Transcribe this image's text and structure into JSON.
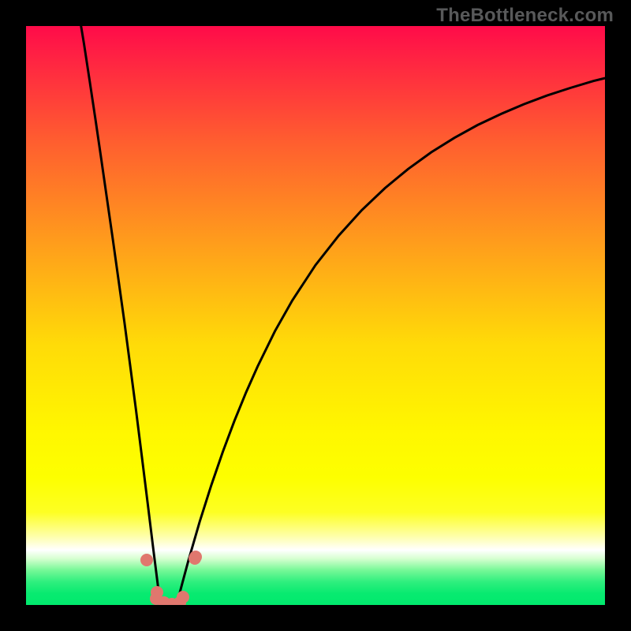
{
  "watermark": "TheBottleneck.com",
  "chart_data": {
    "type": "line",
    "title": "",
    "xlabel": "",
    "ylabel": "",
    "xlim": [
      0,
      100
    ],
    "ylim": [
      0,
      100
    ],
    "series": [
      {
        "name": "left-curve",
        "values_xy": [
          [
            9,
            103
          ],
          [
            10,
            97
          ],
          [
            11,
            90.5
          ],
          [
            12,
            83.8
          ],
          [
            13,
            77
          ],
          [
            14,
            70
          ],
          [
            15,
            63.1
          ],
          [
            16,
            56
          ],
          [
            17,
            48.8
          ],
          [
            18,
            41.3
          ],
          [
            19,
            33.6
          ],
          [
            20,
            25.7
          ],
          [
            21,
            17.7
          ],
          [
            22,
            9.5
          ],
          [
            23.2,
            0
          ]
        ],
        "note": "near-vertical descending branch on left third"
      },
      {
        "name": "right-curve",
        "values_xy": [
          [
            26,
            0
          ],
          [
            27,
            3.8
          ],
          [
            28,
            7.5
          ],
          [
            30,
            14.4
          ],
          [
            32,
            20.7
          ],
          [
            34,
            26.5
          ],
          [
            36,
            31.8
          ],
          [
            38,
            36.7
          ],
          [
            40,
            41.2
          ],
          [
            43,
            47.3
          ],
          [
            46,
            52.6
          ],
          [
            50,
            58.7
          ],
          [
            54,
            63.8
          ],
          [
            58,
            68.2
          ],
          [
            62,
            72
          ],
          [
            66,
            75.3
          ],
          [
            70,
            78.2
          ],
          [
            74,
            80.7
          ],
          [
            78,
            82.9
          ],
          [
            82,
            84.8
          ],
          [
            86,
            86.5
          ],
          [
            90,
            88
          ],
          [
            94,
            89.3
          ],
          [
            98,
            90.5
          ],
          [
            100,
            91
          ]
        ],
        "note": "ascending convex branch reaching toward upper right"
      }
    ],
    "markers": [
      {
        "x": 20.8,
        "y": 7.7,
        "series": "left-curve"
      },
      {
        "x": 22.6,
        "y": 2.2,
        "series": "left-curve"
      },
      {
        "x": 22.5,
        "y": 1.1,
        "series": "left-curve"
      },
      {
        "x": 23.9,
        "y": 0.4,
        "series": "floor"
      },
      {
        "x": 25.2,
        "y": 0.2,
        "series": "floor"
      },
      {
        "x": 26.5,
        "y": 0.4,
        "series": "floor"
      },
      {
        "x": 27.1,
        "y": 1.4,
        "series": "right-curve"
      },
      {
        "x": 29.1,
        "y": 8.0,
        "series": "right-curve"
      },
      {
        "x": 29.3,
        "y": 8.3,
        "series": "right-curve"
      }
    ],
    "background": "vertical rainbow gradient red→orange→yellow→white→green",
    "axes_visible": false,
    "grid": false
  },
  "colors": {
    "frame": "#000000",
    "marker": "#e0776e",
    "curve": "#000000",
    "watermark": "#58595a"
  }
}
